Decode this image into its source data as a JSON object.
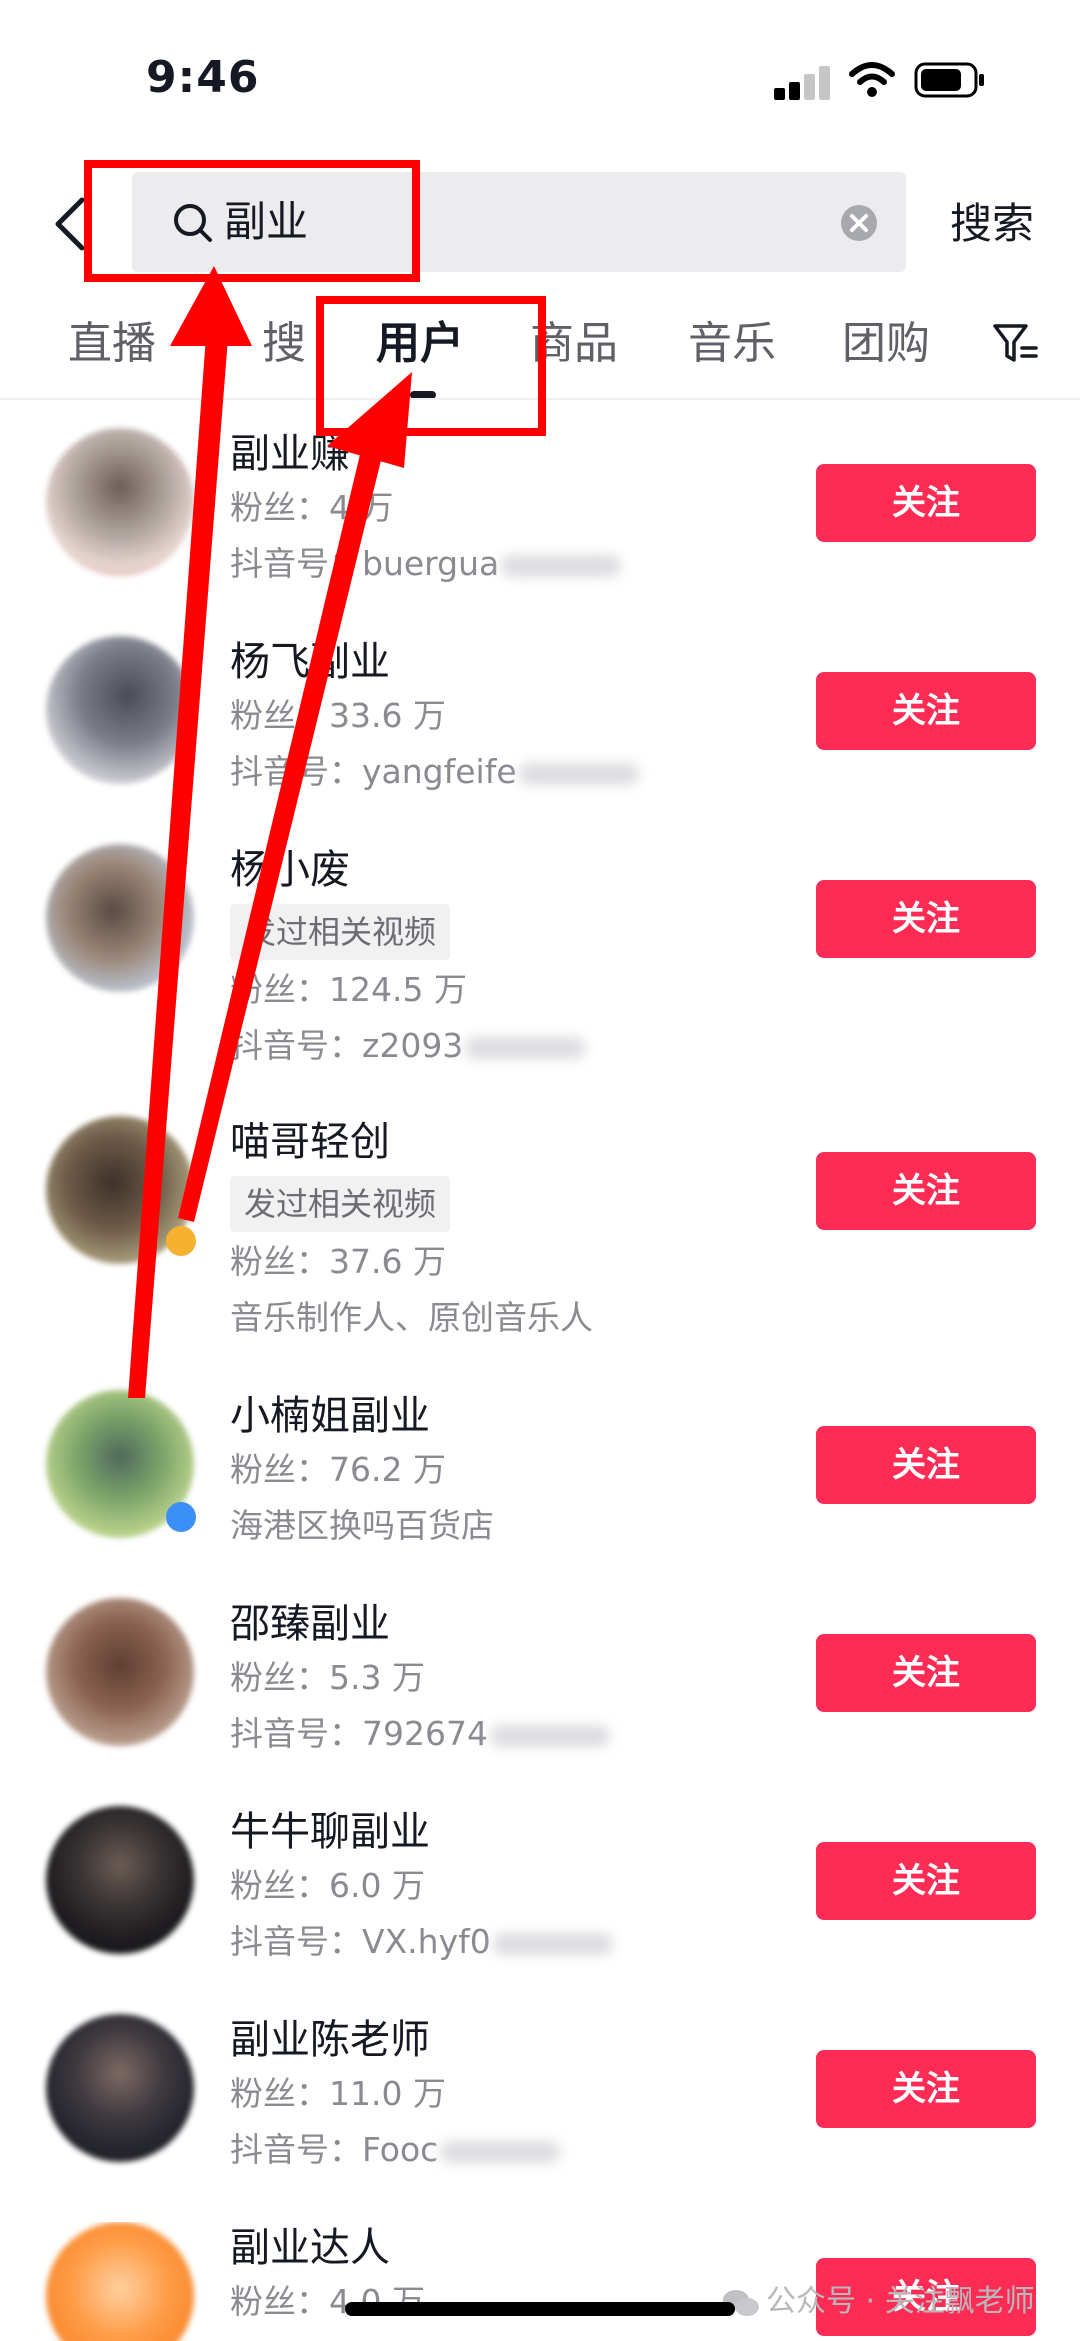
{
  "status_bar": {
    "time": "9:46"
  },
  "search": {
    "query": "副业",
    "submit_label": "搜索"
  },
  "tabs": [
    {
      "label": "直播"
    },
    {
      "label": "搜"
    },
    {
      "label": "用户"
    },
    {
      "label": "商品"
    },
    {
      "label": "音乐"
    },
    {
      "label": "团购"
    }
  ],
  "users": [
    {
      "name": "副业赚",
      "related": "",
      "fans": "粉丝：4  万",
      "meta": "抖音号：buergua"
    },
    {
      "name": "杨飞副业",
      "related": "",
      "fans": "粉丝：33.6 万",
      "meta": "抖音号：yangfeife"
    },
    {
      "name": "杨小废",
      "related": "发过相关视频",
      "fans": "粉丝：124.5 万",
      "meta": "抖音号：z2093"
    },
    {
      "name": "喵哥轻创",
      "related": "发过相关视频",
      "fans": "粉丝：37.6 万",
      "meta": "音乐制作人、原创音乐人"
    },
    {
      "name": "小楠姐副业",
      "related": "",
      "fans": "粉丝：76.2 万",
      "meta": "海港区换吗百货店"
    },
    {
      "name": "邵臻副业",
      "related": "",
      "fans": "粉丝：5.3 万",
      "meta": "抖音号：792674"
    },
    {
      "name": "牛牛聊副业",
      "related": "",
      "fans": "粉丝：6.0 万",
      "meta": "抖音号：VX.hyf0"
    },
    {
      "name": "副业陈老师",
      "related": "",
      "fans": "粉丝：11.0 万",
      "meta": "抖音号：Fooc"
    },
    {
      "name": "副业达人",
      "related": "",
      "fans": "粉丝：4.0 万",
      "meta": ""
    }
  ],
  "follow_label": "关注",
  "watermark": "公众号 · 关注飘老师",
  "colors": {
    "follow": "#fe2c55",
    "annotation": "#ff0000"
  }
}
